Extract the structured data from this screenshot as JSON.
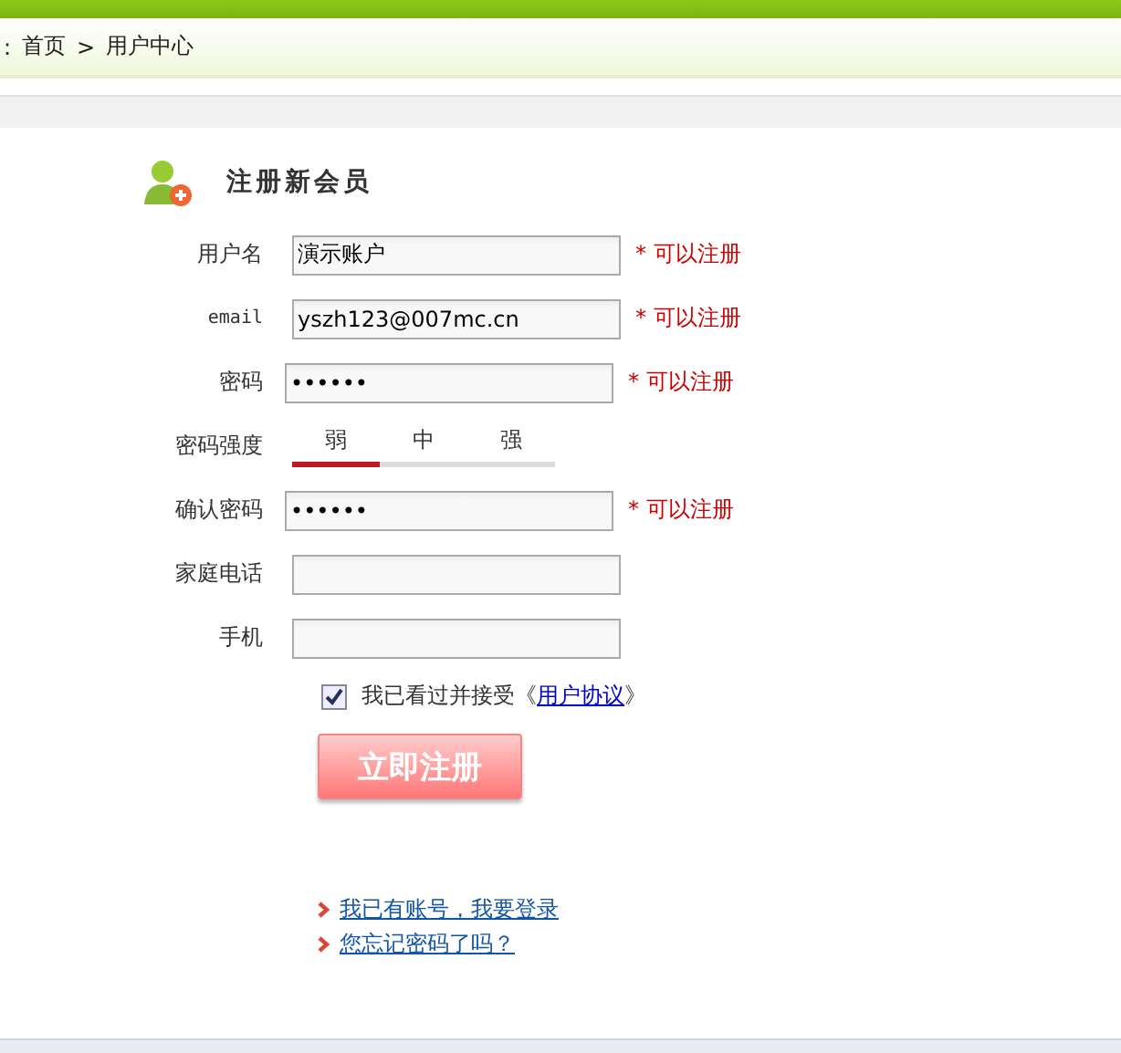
{
  "breadcrumb": {
    "prefix": ":",
    "items": [
      "首页",
      "用户中心"
    ],
    "separator": ">"
  },
  "form": {
    "title": "注册新会员",
    "fields": [
      {
        "kind": "text",
        "label": "用户名",
        "value": "演示账户",
        "hint": "* 可以注册"
      },
      {
        "kind": "text",
        "label": "email",
        "value": "yszh123@007mc.cn",
        "hint": "* 可以注册"
      },
      {
        "kind": "password",
        "label": "密码",
        "value": "••••••",
        "hint": "* 可以注册"
      },
      {
        "kind": "strength",
        "label": "密码强度",
        "levels": [
          {
            "label": "弱",
            "selected": true
          },
          {
            "label": "中",
            "selected": false
          },
          {
            "label": "强",
            "selected": false
          }
        ]
      },
      {
        "kind": "password",
        "label": "确认密码",
        "value": "••••••",
        "hint": "* 可以注册"
      },
      {
        "kind": "text",
        "label": "家庭电话"
      },
      {
        "kind": "text",
        "label": "手机"
      }
    ],
    "agreement": {
      "checked": true,
      "text": "我已看过并接受《",
      "link": "用户协议",
      "suffix": "》"
    },
    "submit": "立即注册",
    "links": [
      "我已有账号，我要登录",
      "您忘记密码了吗？"
    ]
  }
}
